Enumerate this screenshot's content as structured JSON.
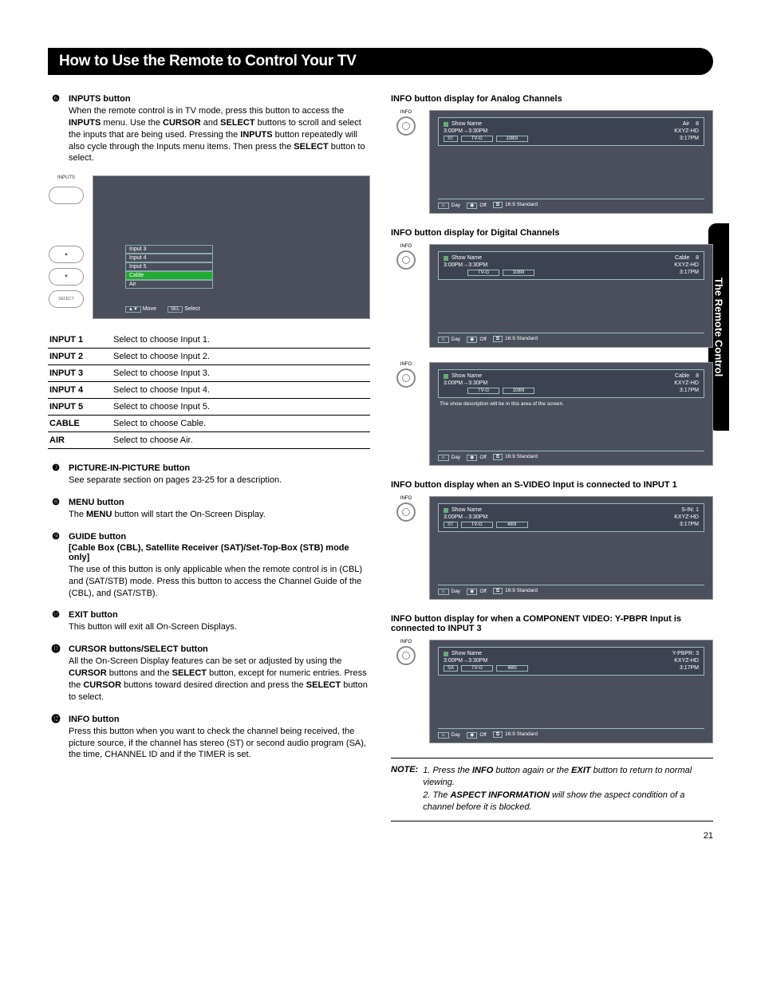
{
  "page_title": "How to Use the Remote to Control Your TV",
  "side_tab": "The Remote Control",
  "page_number": "21",
  "left": {
    "items": [
      {
        "bullet": "❻",
        "title": "INPUTS button",
        "text_parts": {
          "a": "When the remote control is in TV mode, press this button to access the ",
          "b": "INPUTS",
          "c": " menu. Use the ",
          "d": "CURSOR",
          "e": " and ",
          "f": "SELECT",
          "g": " buttons to scroll and select the inputs that are being used. Pressing the ",
          "h": "INPUTS",
          "i": " button repeatedly will also cycle through the Inputs menu items. Then press the ",
          "j": "SELECT",
          "k": " button to select."
        }
      },
      {
        "bullet": "❼",
        "title": "PICTURE-IN-PICTURE button",
        "plain": "See separate section on pages 23-25 for a description."
      },
      {
        "bullet": "❽",
        "title": "MENU button",
        "text_parts": {
          "a": "The ",
          "b": "MENU",
          "c": " button will start the On-Screen Display."
        }
      },
      {
        "bullet": "❾",
        "title": "GUIDE button",
        "subtitle": "[Cable Box (CBL), Satellite Receiver (SAT)/Set-Top-Box (STB) mode only]",
        "plain": "The use of this button is only applicable when the remote control is in (CBL) and (SAT/STB) mode. Press this button to access the Channel Guide of the (CBL), and (SAT/STB)."
      },
      {
        "bullet": "❿",
        "title": "EXIT button",
        "plain": "This button will exit all On-Screen Displays."
      },
      {
        "bullet": "⓫",
        "title": "CURSOR buttons/SELECT button",
        "text_parts": {
          "a": "All the On-Screen Display features can be set or adjusted by using the ",
          "b": "CURSOR",
          "c": " buttons and the ",
          "d": "SELECT",
          "e": " button, except for numeric entries. Press the ",
          "f": "CURSOR",
          "g": " buttons toward desired direction and press the ",
          "h": "SELECT",
          "i": " button to select."
        }
      },
      {
        "bullet": "⓬",
        "title": "INFO button",
        "plain": "Press this button when you want to check the channel being received, the picture source, if the channel has stereo (ST) or second audio program (SA), the time, CHANNEL ID and if the TIMER is set."
      }
    ],
    "inputs_remote": {
      "inputs_label": "INPUTS",
      "select_label": "SELECT",
      "up": "▲",
      "down": "▼"
    },
    "inputs_menu": {
      "items": [
        "Input 3",
        "Input 4",
        "Input 5",
        "Cable",
        "Air"
      ],
      "hint_move_key": "▲▼",
      "hint_move": "Move",
      "hint_sel_key": "SEL",
      "hint_sel": "Select"
    },
    "inputs_table": [
      {
        "key": "INPUT 1",
        "val": "Select to choose Input 1."
      },
      {
        "key": "INPUT 2",
        "val": "Select to choose Input 2."
      },
      {
        "key": "INPUT 3",
        "val": "Select to choose Input 3."
      },
      {
        "key": "INPUT 4",
        "val": "Select to choose Input 4."
      },
      {
        "key": "INPUT 5",
        "val": "Select to choose Input 5."
      },
      {
        "key": "CABLE",
        "val": "Select to choose Cable."
      },
      {
        "key": "AIR",
        "val": "Select to choose Air."
      }
    ]
  },
  "right": {
    "info_label": "INFO",
    "headings": {
      "analog": "INFO button display for Analog Channels",
      "digital": "INFO button display for Digital Channels",
      "svideo": "INFO button display when an S-VIDEO Input is connected to INPUT 1",
      "ypbpr": "INFO button display for when a COMPONENT VIDEO: Y-PBPR Input is connected to INPUT 3"
    },
    "screens": {
      "analog": {
        "show": "Show Name",
        "src": "Air",
        "ch": "8",
        "time": "3:00PM→3:30PM",
        "id": "KXYZ-HD",
        "pills": [
          "ST",
          "TV-G",
          "1080i"
        ],
        "clock": "3:17PM",
        "bottom": {
          "k1": "☼",
          "v1": "Day",
          "k2": "◉",
          "v2": "Off",
          "k3": "⧉",
          "v3": "16:9 Standard"
        }
      },
      "digital1": {
        "show": "Show Name",
        "src": "Cable",
        "ch": "8",
        "time": "3:00PM→3:30PM",
        "id": "KXYZ-HD",
        "pills": [
          "",
          "TV-G",
          "1080i"
        ],
        "clock": "3:17PM",
        "bottom": {
          "k1": "☼",
          "v1": "Day",
          "k2": "◉",
          "v2": "Off",
          "k3": "⧉",
          "v3": "16:9 Standard"
        }
      },
      "digital2": {
        "show": "Show Name",
        "src": "Cable",
        "ch": "8",
        "time": "3:00PM→3:30PM",
        "id": "KXYZ-HD",
        "pills": [
          "",
          "TV-G",
          "1080i"
        ],
        "clock": "3:17PM",
        "desc": "The show description will be in this area of the screen.",
        "bottom": {
          "k1": "☼",
          "v1": "Day",
          "k2": "◉",
          "v2": "Off",
          "k3": "⧉",
          "v3": "16:9 Standard"
        }
      },
      "svideo": {
        "show": "Show Name",
        "src": "S-IN: 1",
        "ch": "",
        "time": "3:00PM→3:30PM",
        "id": "KXYZ-HD",
        "pills": [
          "ST",
          "TV-G",
          "480i"
        ],
        "clock": "3:17PM",
        "bottom": {
          "k1": "☼",
          "v1": "Day",
          "k2": "◉",
          "v2": "Off",
          "k3": "⧉",
          "v3": "16:9 Standard"
        }
      },
      "ypbpr": {
        "show": "Show Name",
        "src": "Y-PBPR: 3",
        "ch": "",
        "time": "3:00PM→3:30PM",
        "id": "KXYZ-HD",
        "pills": [
          "SA",
          "TV-G",
          "480i"
        ],
        "clock": "3:17PM",
        "bottom": {
          "k1": "☼",
          "v1": "Day",
          "k2": "◉",
          "v2": "Off",
          "k3": "⧉",
          "v3": "16:9 Standard"
        }
      }
    }
  },
  "note": {
    "tag": "NOTE:",
    "n1a": "1. Press the ",
    "n1b": "INFO",
    "n1c": " button again or the ",
    "n1d": "EXIT",
    "n1e": " button to return to normal viewing.",
    "n2a": "2. The ",
    "n2b": "ASPECT INFORMATION",
    "n2c": " will show the aspect condition of a channel before it is blocked."
  }
}
